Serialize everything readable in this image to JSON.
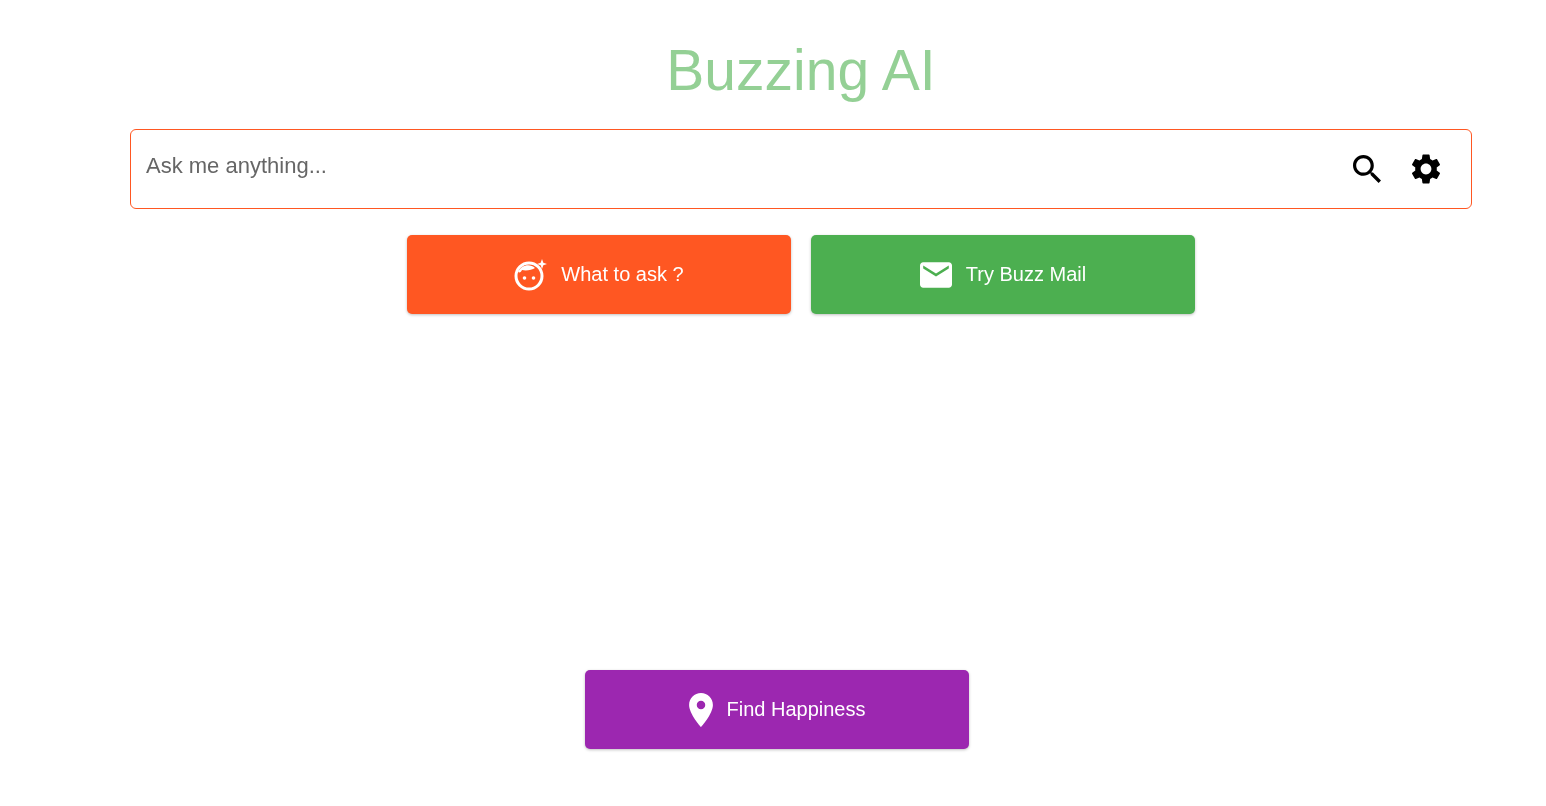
{
  "title": "Buzzing AI",
  "search": {
    "placeholder": "Ask me anything..."
  },
  "actions": [
    {
      "label": "What to ask ?",
      "kind": "ideas"
    },
    {
      "label": "Try Buzz Mail",
      "kind": "mail"
    }
  ],
  "footer_action": {
    "label": "Find Happiness",
    "kind": "location"
  }
}
